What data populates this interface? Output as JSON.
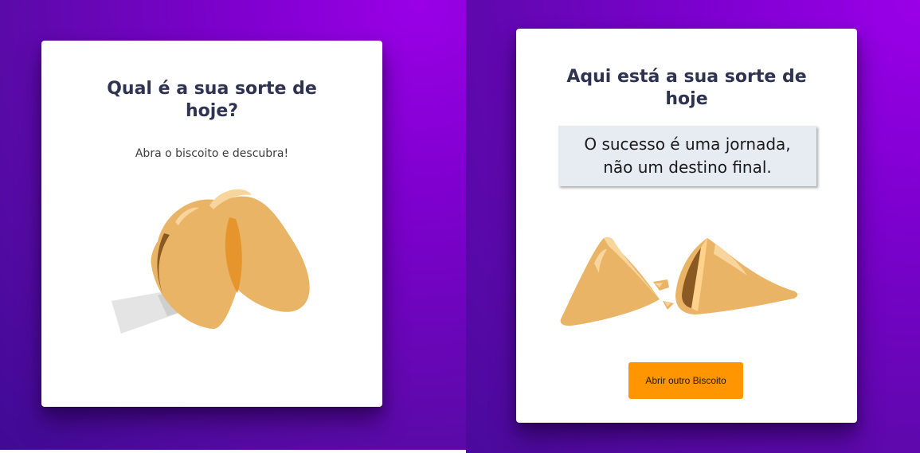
{
  "left_card": {
    "title": "Qual é a sua sorte de hoje?",
    "subtitle": "Abra o biscoito e descubra!",
    "image_icon": "closed-fortune-cookie-icon"
  },
  "right_card": {
    "title": "Aqui está a sua sorte de hoje",
    "fortune": "O sucesso é uma jornada, não um destino final.",
    "image_icon": "broken-fortune-cookie-icon",
    "button_label": "Abrir outro Biscoito"
  },
  "colors": {
    "background_purple": "#8000d2",
    "button_orange": "#ff9500",
    "title_text": "#2f3352",
    "cookie": "#eab467"
  }
}
